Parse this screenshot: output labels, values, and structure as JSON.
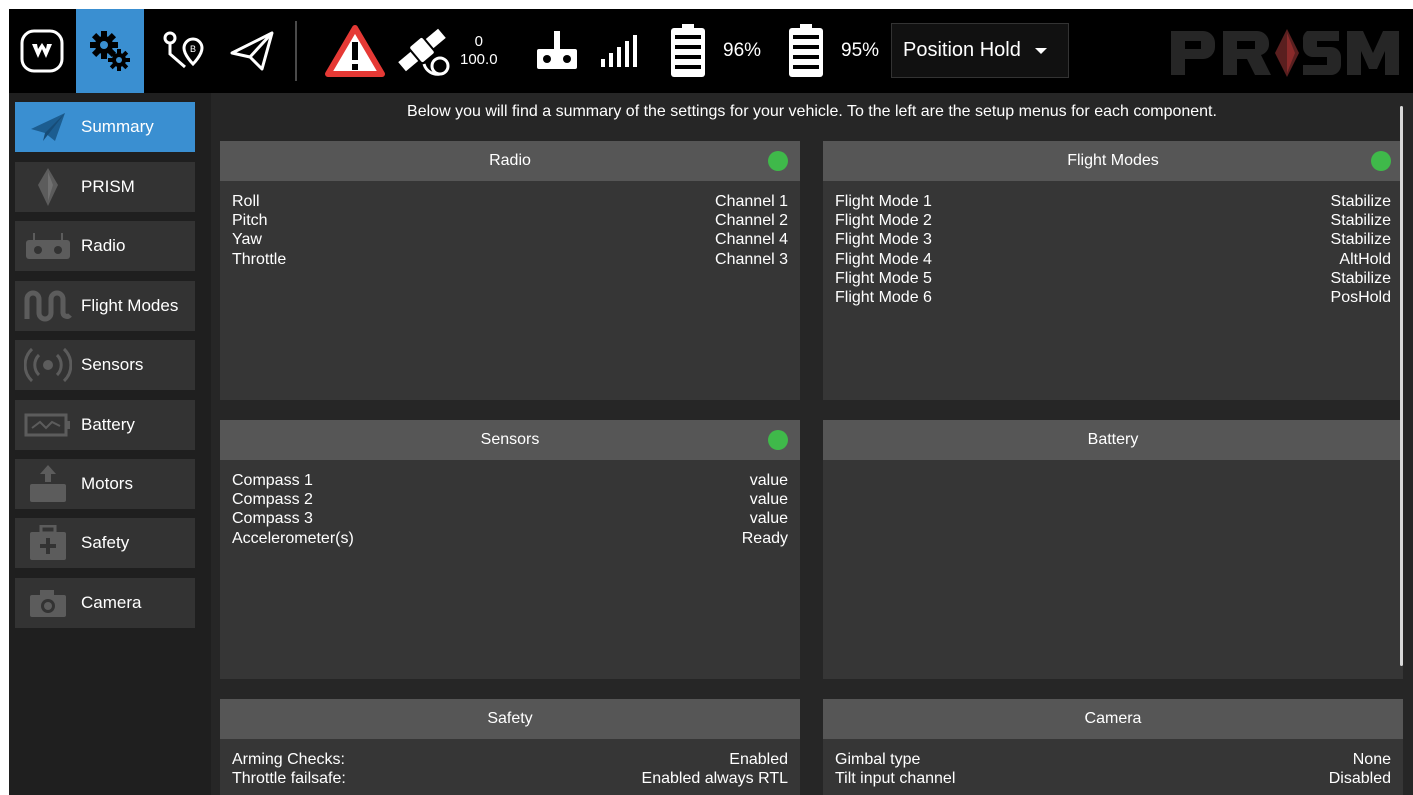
{
  "toolbar": {
    "logo_icon": "app-logo-icon",
    "gps": {
      "satellites": "0",
      "hdop": "100.0"
    },
    "battery_1": {
      "percent": "96%"
    },
    "battery_2": {
      "percent": "95%"
    },
    "flight_mode": "Position Hold",
    "brand_text": "PR SM",
    "accent_color": "#3a8fd1",
    "warning_color": "#e53935"
  },
  "sidebar": {
    "items": [
      {
        "label": "Summary",
        "icon": "paper-plane-icon",
        "active": true
      },
      {
        "label": "PRISM",
        "icon": "diamond-icon"
      },
      {
        "label": "Radio",
        "icon": "radio-icon"
      },
      {
        "label": "Flight Modes",
        "icon": "waveform-icon"
      },
      {
        "label": "Sensors",
        "icon": "broadcast-icon"
      },
      {
        "label": "Battery",
        "icon": "battery-icon"
      },
      {
        "label": "Motors",
        "icon": "motor-icon"
      },
      {
        "label": "Safety",
        "icon": "first-aid-icon"
      },
      {
        "label": "Camera",
        "icon": "camera-icon"
      }
    ]
  },
  "main": {
    "intro": "Below you will find a summary of the settings for your vehicle. To the left are the setup menus for each component.",
    "status_ok_color": "#3fb94a",
    "cards": {
      "radio": {
        "title": "Radio",
        "rows": [
          {
            "label": "Roll",
            "value": "Channel 1"
          },
          {
            "label": "Pitch",
            "value": "Channel 2"
          },
          {
            "label": "Yaw",
            "value": "Channel 4"
          },
          {
            "label": "Throttle",
            "value": "Channel 3"
          }
        ]
      },
      "flight_modes": {
        "title": "Flight Modes",
        "rows": [
          {
            "label": "Flight Mode 1",
            "value": "Stabilize"
          },
          {
            "label": "Flight Mode 2",
            "value": "Stabilize"
          },
          {
            "label": "Flight Mode 3",
            "value": "Stabilize"
          },
          {
            "label": "Flight Mode 4",
            "value": "AltHold"
          },
          {
            "label": "Flight Mode 5",
            "value": "Stabilize"
          },
          {
            "label": "Flight Mode 6",
            "value": "PosHold"
          }
        ]
      },
      "sensors": {
        "title": "Sensors",
        "rows": [
          {
            "label": "Compass 1",
            "value": "value"
          },
          {
            "label": "Compass 2",
            "value": "value"
          },
          {
            "label": "Compass 3",
            "value": "value"
          },
          {
            "label": "Accelerometer(s)",
            "value": "Ready"
          }
        ]
      },
      "battery": {
        "title": "Battery"
      },
      "safety": {
        "title": "Safety",
        "rows": [
          {
            "label": "Arming Checks:",
            "value": "Enabled"
          },
          {
            "label": "Throttle failsafe:",
            "value": "Enabled always RTL"
          }
        ]
      },
      "camera": {
        "title": "Camera",
        "rows": [
          {
            "label": "Gimbal type",
            "value": "None"
          },
          {
            "label": "Tilt input channel",
            "value": "Disabled"
          }
        ]
      }
    }
  }
}
